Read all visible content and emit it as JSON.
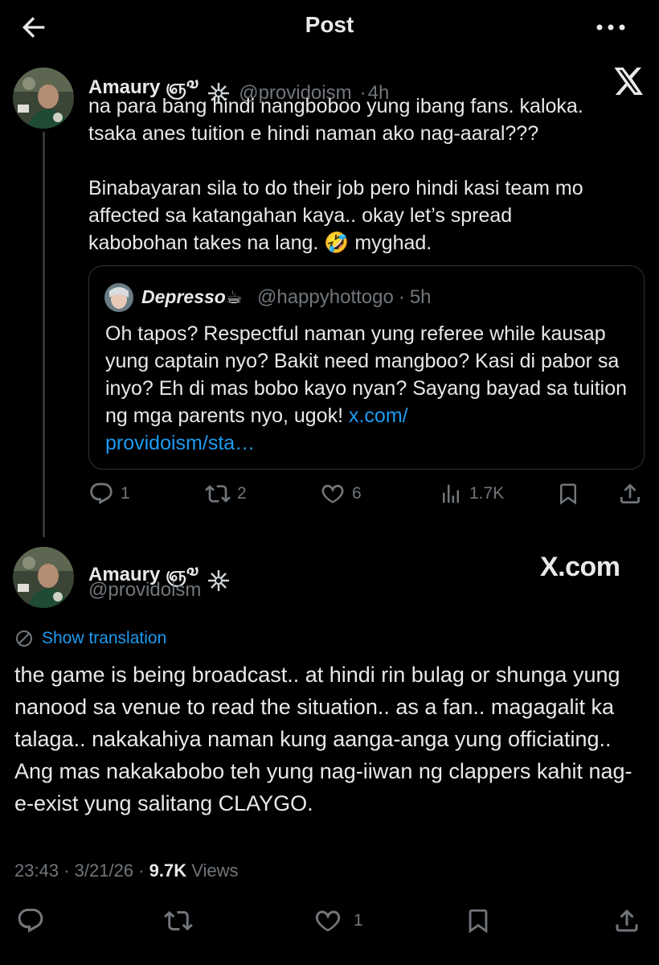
{
  "header": {
    "title": "Post"
  },
  "first_tweet": {
    "author_name": "Amaury ஞ༧",
    "handle": "@providoism",
    "separator": "·",
    "time": "4h",
    "text": "na para bang hindi nangboboo yung ibang fans. kaloka.\ntsaka anes tuition e hindi naman ako nag-aaral???\n\nBinabayaran sila to do their job pero hindi kasi team mo\naffected sa katangahan kaya.. okay let’s spread\nkabobohan takes na lang. 🤣 myghad.",
    "quote": {
      "author_name": "Depresso☕",
      "handle": "@happyhottogo",
      "separator": "·",
      "time": "5h",
      "text": "Oh tapos? Respectful naman yung referee while kausap yung captain nyo? Bakit need mangboo? Kasi di pabor sa inyo? Eh di mas bobo kayo nyan? Sayang bayad sa tuition ng mga parents nyo, ugok!",
      "link": "x.com/\nprovidoism/sta…"
    },
    "actions": {
      "replies": "1",
      "reposts": "2",
      "likes": "6",
      "views": "1.7K"
    }
  },
  "main_tweet": {
    "author_name": "Amaury ஞ༧",
    "handle": "@providoism",
    "watermark": "X.com",
    "show_translation": "Show translation",
    "text": "the game is being broadcast.. at hindi rin bulag or shunga yung nanood sa venue to read the situation.. as a fan.. magagalit ka talaga.. nakakahiya naman kung aanga-anga yung officiating.. Ang mas nakakabobo teh yung nag-iiwan ng clappers kahit nag-e-exist yung salitang CLAYGO.",
    "time": "23:43",
    "date": "3/21/26",
    "separator": "·",
    "views_count": "9.7K",
    "views_label": "Views",
    "actions": {
      "likes": "1"
    }
  },
  "icons": {
    "back": "arrow-left-icon",
    "more": "more-horizontal-icon",
    "x_logo": "x-logo-icon",
    "reply": "reply-icon",
    "repost": "repost-icon",
    "like": "heart-icon",
    "views": "views-icon",
    "bookmark": "bookmark-icon",
    "share": "share-icon",
    "globe": "globe-icon"
  },
  "colors": {
    "background": "#000000",
    "text": "#e7e9ea",
    "muted": "#71767b",
    "accent": "#1d9bf0",
    "border": "#2f3336"
  }
}
